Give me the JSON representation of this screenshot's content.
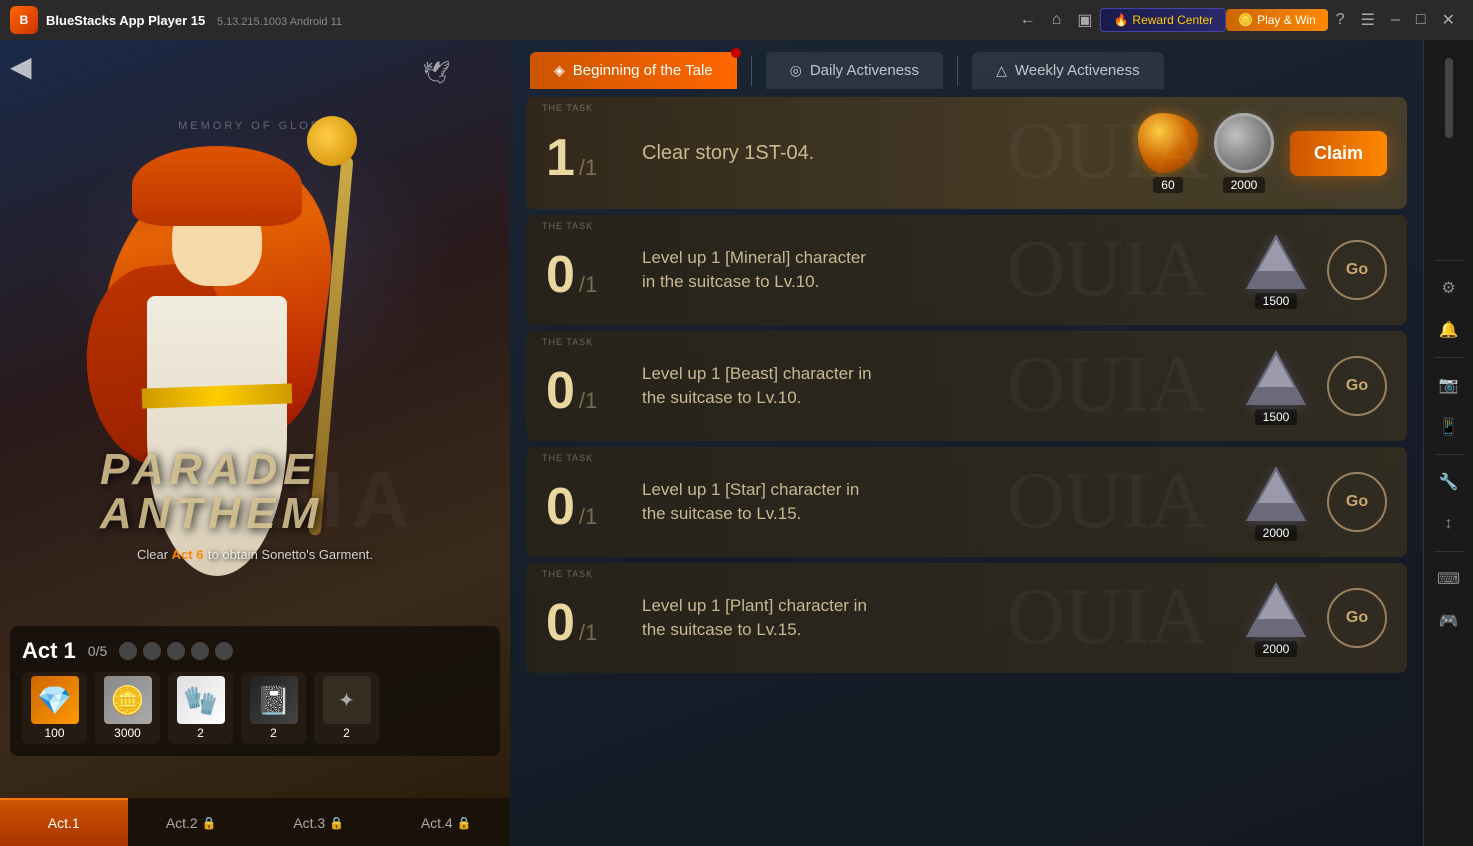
{
  "titleBar": {
    "logoText": "B",
    "appName": "BlueStacks App Player 15",
    "version": "5.13.215.1003  Android 11",
    "rewardCenter": "Reward Center",
    "playWin": "Play & Win"
  },
  "tabs": {
    "beginning": "Beginning of the Tale",
    "daily": "Daily Activeness",
    "weekly": "Weekly Activeness"
  },
  "tasks": [
    {
      "id": 1,
      "label": "THE TASK",
      "progress": "1",
      "total": "1",
      "description": "Clear story 1ST-04.",
      "rewardType": "amber+coin",
      "rewardAmber": 60,
      "rewardCoin": 2000,
      "actionLabel": "Claim",
      "actionType": "claim"
    },
    {
      "id": 2,
      "label": "THE TASK",
      "progress": "0",
      "total": "1",
      "description": "Level up 1 [Mineral] character\nin the suitcase to Lv.10.",
      "rewardType": "gem",
      "rewardValue": 1500,
      "actionLabel": "Go",
      "actionType": "go"
    },
    {
      "id": 3,
      "label": "THE TASK",
      "progress": "0",
      "total": "1",
      "description": "Level up 1 [Beast] character in\nthe suitcase to Lv.10.",
      "rewardType": "gem",
      "rewardValue": 1500,
      "actionLabel": "Go",
      "actionType": "go"
    },
    {
      "id": 4,
      "label": "THE TASK",
      "progress": "0",
      "total": "1",
      "description": "Level up 1 [Star] character in\nthe suitcase to Lv.15.",
      "rewardType": "gem",
      "rewardValue": 2000,
      "actionLabel": "Go",
      "actionType": "go"
    },
    {
      "id": 5,
      "label": "THE TASK",
      "progress": "0",
      "total": "1",
      "description": "Level up 1 [Plant] character in\nthe suitcase to Lv.15.",
      "rewardType": "gem",
      "rewardValue": 2000,
      "actionLabel": "Go",
      "actionType": "go"
    }
  ],
  "actPanel": {
    "actTitle": "Act 1",
    "progressText": "0/5",
    "rewards": [
      {
        "type": "amber",
        "icon": "💎",
        "count": "100"
      },
      {
        "type": "coin",
        "icon": "🪙",
        "count": "3000"
      },
      {
        "type": "glove",
        "icon": "🧤",
        "count": "2"
      },
      {
        "type": "book",
        "icon": "📓",
        "count": "2"
      },
      {
        "type": "more",
        "icon": "✦",
        "count": "2"
      }
    ]
  },
  "actTabs": [
    {
      "id": "act1",
      "label": "Act.1",
      "active": true,
      "locked": false
    },
    {
      "id": "act2",
      "label": "Act.2",
      "active": false,
      "locked": true
    },
    {
      "id": "act3",
      "label": "Act.3",
      "active": false,
      "locked": true
    },
    {
      "id": "act4",
      "label": "Act.4",
      "active": false,
      "locked": true
    }
  ],
  "gameInfo": {
    "subtitle": "Clear Act 6 to obtain Sonetto's Garment.",
    "actHighlight": "Act 6",
    "memoryText": "MEMORY OF GLORY",
    "gameTitle1": "PARADE",
    "gameTitle2": "ANTHEM"
  },
  "sideTools": [
    "⚙",
    "🔔",
    "📷",
    "📱",
    "🔧",
    "↕"
  ]
}
